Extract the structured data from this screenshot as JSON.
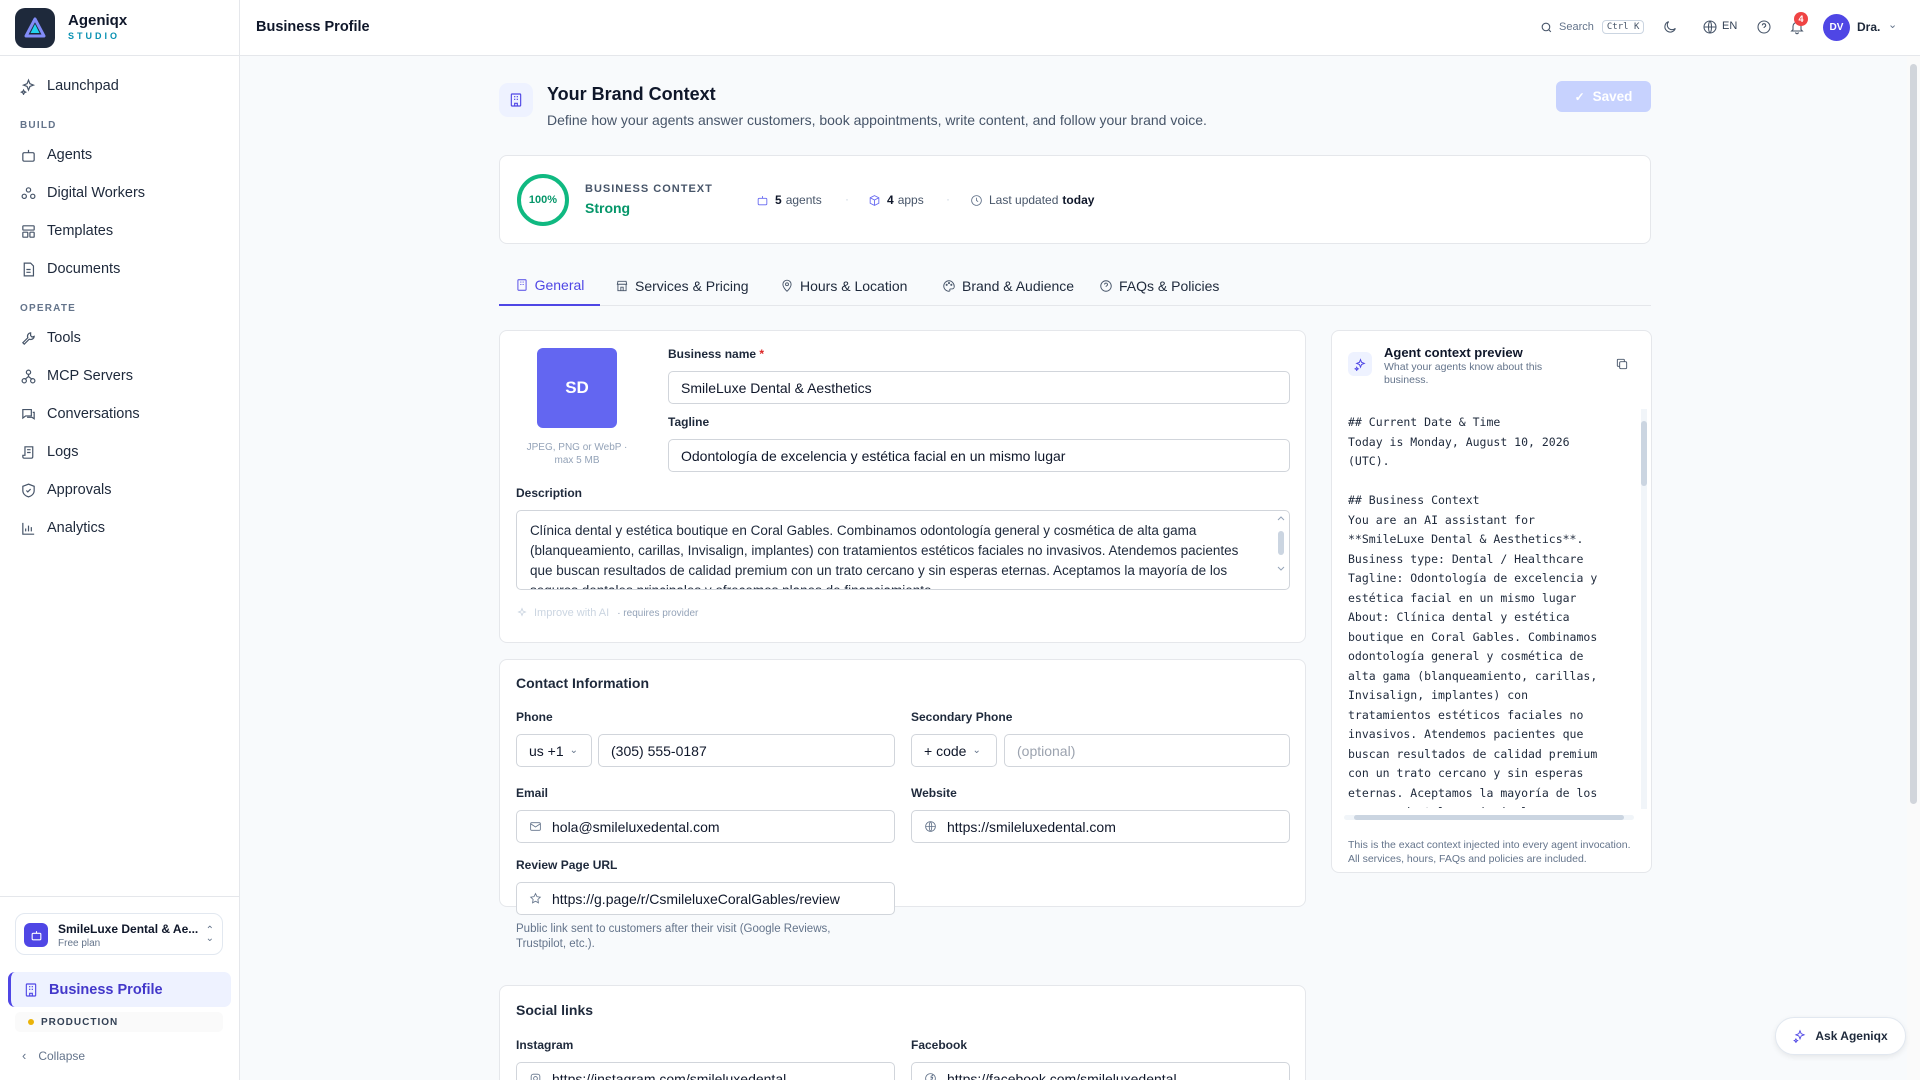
{
  "app": {
    "name": "Ageniqx",
    "sub": "STUDIO"
  },
  "nav": {
    "launchpad": "Launchpad",
    "build_label": "BUILD",
    "build": [
      "Agents",
      "Digital Workers",
      "Templates",
      "Documents"
    ],
    "operate_label": "OPERATE",
    "operate": [
      "Tools",
      "MCP Servers",
      "Conversations",
      "Logs",
      "Approvals",
      "Analytics"
    ]
  },
  "workspace": {
    "name": "SmileLuxe Dental & Ae...",
    "plan": "Free plan"
  },
  "active_page": "Business Profile",
  "env": "PRODUCTION",
  "collapse": "Collapse",
  "topbar": {
    "title": "Business Profile",
    "search": "Search",
    "shortcut": "Ctrl K",
    "lang": "EN",
    "notifications": "4",
    "avatar": "DV",
    "user": "Dra."
  },
  "header": {
    "title": "Your Brand Context",
    "subtitle": "Define how your agents answer customers, book appointments, write content, and follow your brand voice.",
    "saved": "Saved"
  },
  "context": {
    "percent": "100%",
    "label": "BUSINESS CONTEXT",
    "strength": "Strong",
    "agents_count": "5",
    "agents_label": "agents",
    "apps_count": "4",
    "apps_label": "apps",
    "updated_label": "Last updated",
    "updated_value": "today"
  },
  "tabs": [
    "General",
    "Services & Pricing",
    "Hours & Location",
    "Brand & Audience",
    "FAQs & Policies"
  ],
  "general": {
    "logo_initials": "SD",
    "logo_caption": "JPEG, PNG or WebP · max 5 MB",
    "business_name_label": "Business name",
    "business_name": "SmileLuxe Dental & Aesthetics",
    "tagline_label": "Tagline",
    "tagline": "Odontología de excelencia y estética facial en un mismo lugar",
    "description_label": "Description",
    "description": "Clínica dental y estética boutique en Coral Gables. Combinamos odontología general y cosmética de alta gama (blanqueamiento, carillas, Invisalign, implantes) con tratamientos estéticos faciales no invasivos. Atendemos pacientes que buscan resultados de calidad premium con un trato cercano y sin esperas eternas. Aceptamos la mayoría de los seguros dentales principales y ofrecemos planes de financiamiento.",
    "improve": "Improve with AI",
    "requires": "· requires provider"
  },
  "contact": {
    "title": "Contact Information",
    "phone_label": "Phone",
    "phone_code": "us +1",
    "phone": "(305) 555-0187",
    "secondary_label": "Secondary Phone",
    "secondary_code": "+ code",
    "secondary_placeholder": "(optional)",
    "email_label": "Email",
    "email": "hola@smileluxedental.com",
    "website_label": "Website",
    "website": "https://smileluxedental.com",
    "review_label": "Review Page URL",
    "review": "https://g.page/r/CsmileluxeCoralGables/review",
    "review_help": "Public link sent to customers after their visit (Google Reviews, Trustpilot, etc.)."
  },
  "social": {
    "title": "Social links",
    "instagram_label": "Instagram",
    "instagram": "https://instagram.com/smileluxedental",
    "facebook_label": "Facebook",
    "facebook": "https://facebook.com/smileluxedental"
  },
  "preview": {
    "title": "Agent context preview",
    "subtitle": "What your agents know about this business.",
    "code": "## Current Date & Time\nToday is Monday, August 10, 2026\n(UTC).\n\n## Business Context\nYou are an AI assistant for\n**SmileLuxe Dental & Aesthetics**.\nBusiness type: Dental / Healthcare\nTagline: Odontología de excelencia y\nestética facial en un mismo lugar\nAbout: Clínica dental y estética\nboutique en Coral Gables. Combinamos\nodontología general y cosmética de\nalta gama (blanqueamiento, carillas,\nInvisalign, implantes) con\ntratamientos estéticos faciales no\ninvasivos. Atendemos pacientes que\nbuscan resultados de calidad premium\ncon un trato cercano y sin esperas\neternas. Aceptamos la mayoría de los\nseguros dentales principales",
    "footer": "This is the exact context injected into every agent invocation. All services, hours, FAQs and policies are included."
  },
  "ask": "Ask Ageniqx",
  "colors": {
    "accent": "#4f46e5",
    "success": "#10b981",
    "badge": "#ef4444"
  }
}
